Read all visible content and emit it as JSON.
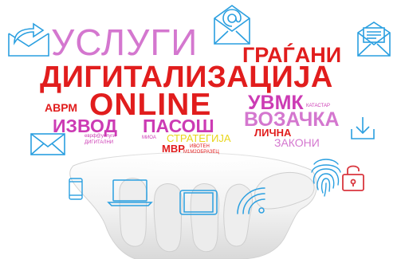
{
  "cloud": {
    "uslugi": "УСЛУГИ",
    "gragani": "ГРАЃАНИ",
    "digitalizacija": "ДИГИТАЛИЗАЦИЈА",
    "online": "ONLINE",
    "avrm": "АВРМ",
    "uvmk": "УВМК",
    "katastar": "КАТАСТАР",
    "izvod": "ИЗВОД",
    "pasos": "ПАСОШ",
    "vozacka": "ВОЗАЧКА",
    "lichna": "ЛИЧНА",
    "zakoni": "ЗАКОНИ",
    "strategija": "СТРАТЕГИЈА",
    "mvr": "МВР",
    "eusluga": "еврф@услуги",
    "digitalni": "ДИГИТАЛНИ",
    "mioa": "МИОА",
    "ivoten": "ИВОТЕН",
    "obrazec": "М1М2ОБРАЗЕЦ"
  },
  "colors": {
    "red": "#e11d1d",
    "magenta": "#cc3bb4",
    "orchid": "#d477cf",
    "yellow": "#e8d61c",
    "icon_blue": "#2a9fe0",
    "lock_red": "#d9363e"
  },
  "icons": [
    "reply-email-icon",
    "at-email-icon",
    "newsletter-email-icon",
    "envelope-icon",
    "download-icon",
    "fingerprint-icon",
    "padlock-icon",
    "smartphone-icon",
    "laptop-icon",
    "tablet-icon",
    "wifi-icon",
    "hand-image"
  ]
}
